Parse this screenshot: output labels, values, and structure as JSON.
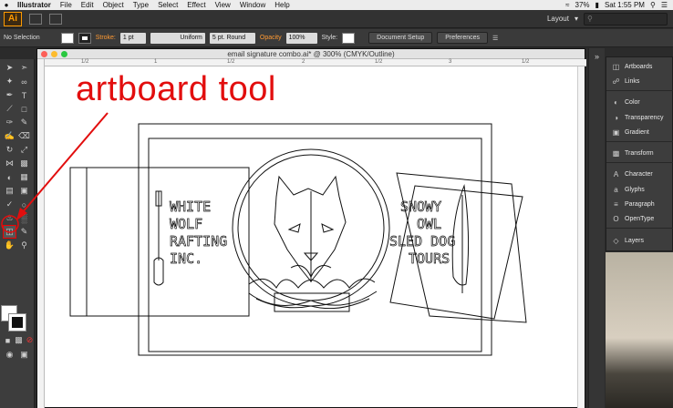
{
  "menubar": {
    "app": "Illustrator",
    "items": [
      "File",
      "Edit",
      "Object",
      "Type",
      "Select",
      "Effect",
      "View",
      "Window",
      "Help"
    ],
    "battery": "37%",
    "clock": "Sat 1:55 PM"
  },
  "appbar": {
    "logo": "Ai",
    "workspace": "Layout"
  },
  "control": {
    "selection": "No Selection",
    "stroke_label": "Stroke:",
    "stroke_value": "1 pt",
    "profile": "Uniform",
    "brush": "5 pt. Round",
    "opacity_label": "Opacity",
    "opacity_value": "100%",
    "style_label": "Style:",
    "doc_setup": "Document Setup",
    "preferences": "Preferences"
  },
  "document": {
    "title": "email signature combo.ai* @ 300% (CMYK/Outline)",
    "ruler_marks": [
      "1/2",
      "1",
      "1/2",
      "2",
      "1/2",
      "3",
      "1/2"
    ]
  },
  "artwork": {
    "left_text": [
      "WHITE",
      "WOLF",
      "RAFTING",
      "INC."
    ],
    "right_text": [
      "SNOWY",
      "OWL",
      "SLED DOG",
      "TOURS"
    ]
  },
  "panel": {
    "items": [
      {
        "label": "Artboards",
        "icon": "artboards-icon"
      },
      {
        "label": "Links",
        "icon": "links-icon"
      },
      {
        "label": "Color",
        "icon": "color-icon"
      },
      {
        "label": "Transparency",
        "icon": "transparency-icon"
      },
      {
        "label": "Gradient",
        "icon": "gradient-icon"
      },
      {
        "label": "Transform",
        "icon": "transform-icon"
      },
      {
        "label": "Character",
        "icon": "character-icon"
      },
      {
        "label": "Glyphs",
        "icon": "glyphs-icon"
      },
      {
        "label": "Paragraph",
        "icon": "paragraph-icon"
      },
      {
        "label": "OpenType",
        "icon": "opentype-icon"
      },
      {
        "label": "Layers",
        "icon": "layers-icon"
      }
    ]
  },
  "annotation": {
    "text": "artboard tool",
    "color": "#e20e0e"
  }
}
